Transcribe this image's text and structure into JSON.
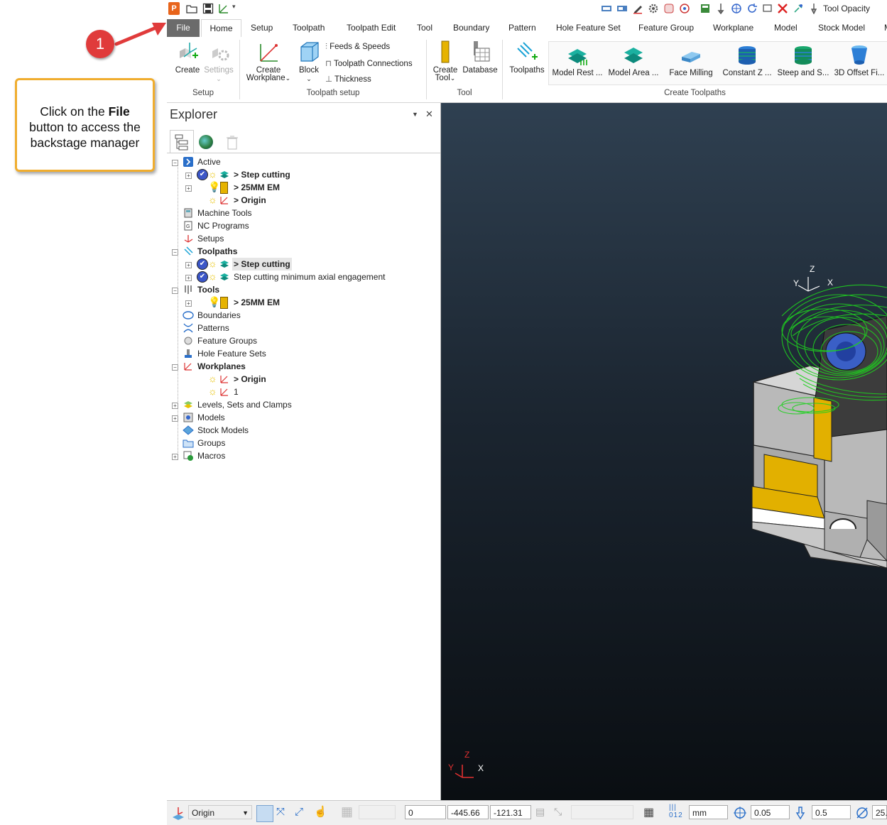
{
  "callout": {
    "text_prefix": "Click on the ",
    "text_bold": "File",
    "text_suffix": " button to access the backstage manager"
  },
  "step_badge": "1",
  "qat": {
    "tool_opacity_label": "Tool Opacity"
  },
  "tabs": [
    {
      "label": "File"
    },
    {
      "label": "Home"
    },
    {
      "label": "Setup"
    },
    {
      "label": "Toolpath"
    },
    {
      "label": "Toolpath Edit"
    },
    {
      "label": "Tool"
    },
    {
      "label": "Boundary"
    },
    {
      "label": "Pattern"
    },
    {
      "label": "Hole Feature Set"
    },
    {
      "label": "Feature Group"
    },
    {
      "label": "Workplane"
    },
    {
      "label": "Model"
    },
    {
      "label": "Stock Model"
    },
    {
      "label": "M"
    }
  ],
  "ribbon": {
    "setup": {
      "create": "Create",
      "settings": "Settings",
      "group": "Setup"
    },
    "toolpath_setup": {
      "create_workplane_1": "Create",
      "create_workplane_2": "Workplane",
      "block": "Block",
      "feeds": "Feeds & Speeds",
      "connections": "Toolpath Connections",
      "thickness": "Thickness",
      "group": "Toolpath setup"
    },
    "tool": {
      "create_tool_1": "Create",
      "create_tool_2": "Tool",
      "database": "Database",
      "group": "Tool"
    },
    "create_toolpaths": {
      "toolpaths": "Toolpaths",
      "model_rest": "Model Rest ...",
      "model_area": "Model Area ...",
      "face_milling": "Face Milling",
      "constant_z": "Constant Z ...",
      "steep_shallow": "Steep and S...",
      "offset_3d": "3D Offset Fi...",
      "group": "Create Toolpaths"
    }
  },
  "explorer": {
    "title": "Explorer",
    "active": "Active",
    "active_toolpath": "> Step cutting",
    "active_tool": "> 25MM EM",
    "active_workplane": "> Origin",
    "machine_tools": "Machine Tools",
    "nc_programs": "NC Programs",
    "setups": "Setups",
    "toolpaths": "Toolpaths",
    "toolpath_1": "> Step cutting",
    "toolpath_2": "Step cutting minimum axial engagement",
    "tools": "Tools",
    "tool_1": "> 25MM EM",
    "boundaries": "Boundaries",
    "patterns": "Patterns",
    "feature_groups": "Feature Groups",
    "hole_feature_sets": "Hole Feature Sets",
    "workplanes": "Workplanes",
    "workplane_1": "> Origin",
    "workplane_2": "1",
    "levels": "Levels, Sets and Clamps",
    "models": "Models",
    "stock_models": "Stock Models",
    "groups": "Groups",
    "macros": "Macros"
  },
  "viewport": {
    "axis_x": "X",
    "axis_y": "Y",
    "axis_z": "Z"
  },
  "status": {
    "workplane": "Origin",
    "x": "0",
    "y": "-445.66",
    "z": "-121.31",
    "units": "mm",
    "tolerance": "0.05",
    "thickness": "0.5",
    "extra": "25."
  },
  "colors": {
    "file_tab": "#6b6b6b",
    "callout_border": "#f0ad2e",
    "badge": "#e03b3b",
    "toolpath": "#1fd11f",
    "stock": "#e2b000"
  }
}
